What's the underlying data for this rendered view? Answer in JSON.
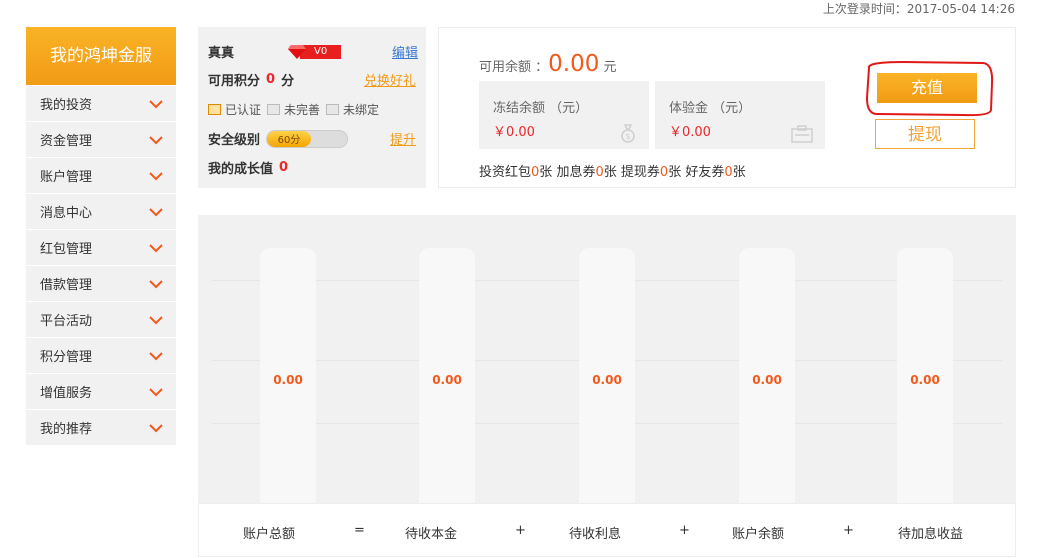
{
  "top": {
    "last_login": "上次登录时间：2017-05-04 14:26"
  },
  "sidebar": {
    "title": "我的鸿坤金服",
    "items": [
      {
        "label": "我的投资"
      },
      {
        "label": "资金管理"
      },
      {
        "label": "账户管理"
      },
      {
        "label": "消息中心"
      },
      {
        "label": "红包管理"
      },
      {
        "label": "借款管理"
      },
      {
        "label": "平台活动"
      },
      {
        "label": "积分管理"
      },
      {
        "label": "增值服务"
      },
      {
        "label": "我的推荐"
      }
    ]
  },
  "user": {
    "name": "真真",
    "vip": "V0",
    "edit": "编辑",
    "points_label": "可用积分",
    "points": "0",
    "points_unit": "分",
    "redeem": "兑换好礼",
    "tag_verified": "已认证",
    "tag_incomplete": "未完善",
    "tag_unbound": "未绑定",
    "security_label": "安全级别",
    "security_score": "60分",
    "security_level": 0.55,
    "improve": "提升",
    "growth_label": "我的成长值",
    "growth": "0"
  },
  "balance": {
    "available_label": "可用余额 ：",
    "available": "0.00",
    "available_unit": "元",
    "frozen_label": "冻结余额 （元）",
    "frozen": "￥0.00",
    "trial_label": "体验金 （元）",
    "trial": "￥0.00",
    "coupons": {
      "c1_label": "投资红包",
      "c1": "0",
      "c2_label": "加息券",
      "c2": "0",
      "c3_label": "提现券",
      "c3": "0",
      "c4_label": "好友券",
      "c4": "0",
      "unit": "张"
    },
    "recharge": "充值",
    "withdraw": "提现"
  },
  "stats": {
    "values": [
      "0.00",
      "0.00",
      "0.00",
      "0.00",
      "0.00"
    ],
    "labels": [
      "账户总额",
      "待收本金",
      "待收利息",
      "账户余额",
      "待加息收益"
    ],
    "ops": [
      "=",
      "+",
      "+",
      "+"
    ]
  },
  "colors": {
    "accent": "#f29b16",
    "value": "#f2591b",
    "red": "#e8292a"
  }
}
